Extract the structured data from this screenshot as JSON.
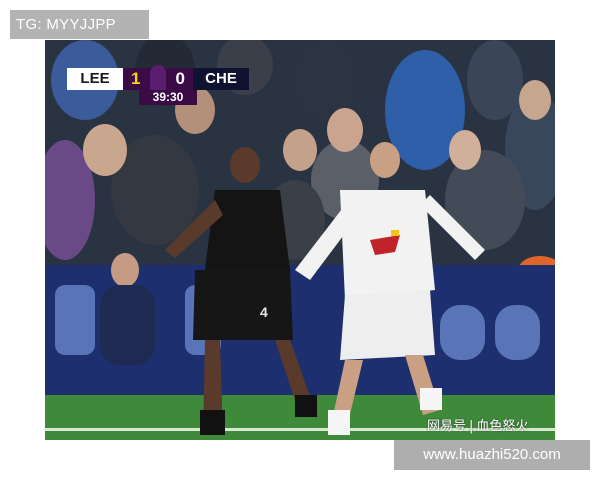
{
  "overlay": {
    "top_label": "TG: MYYJJPP",
    "bottom_banner": "www.huazhi520.com"
  },
  "scorebug": {
    "home_team": "LEE",
    "home_score": "1",
    "away_score": "0",
    "away_team": "CHE",
    "clock": "39:30",
    "competition_logo_icon": "premier-league-lion-icon"
  },
  "source_mark": {
    "platform": "网易号",
    "separator": "|",
    "author": "血色怒火"
  },
  "kits": {
    "home_shirt_number_visible": "",
    "away_shirt_number": "4"
  },
  "colors": {
    "scorebug_purple": "#3a0b45",
    "home_score_yellow": "#f6d21c",
    "pitch_green": "#3f8a3a",
    "advert_board_blue": "#1d2f6f",
    "home_kit": "#f2f2f2",
    "away_kit": "#141414"
  }
}
